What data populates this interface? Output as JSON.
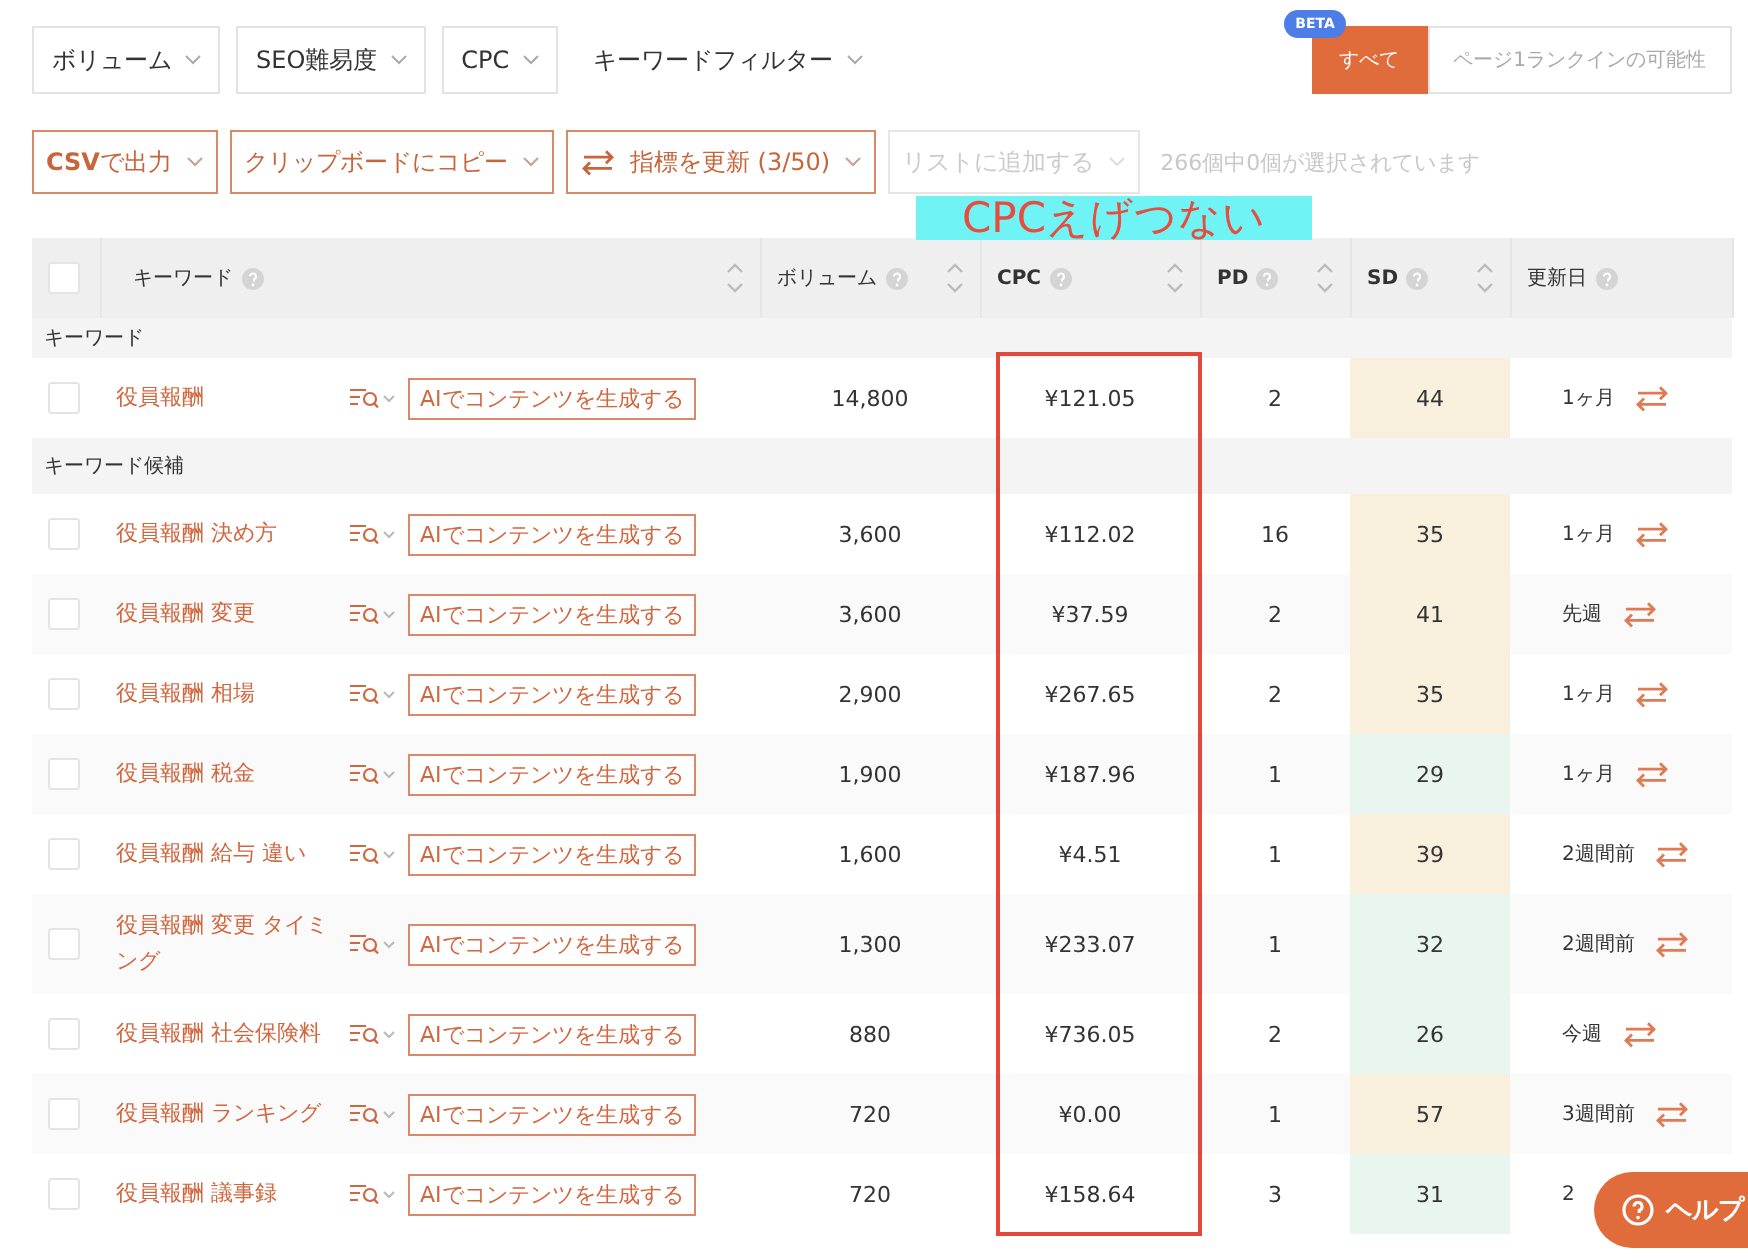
{
  "filters": [
    {
      "label": "ボリューム",
      "boxed": true
    },
    {
      "label": "SEO難易度",
      "boxed": true
    },
    {
      "label": "CPC",
      "boxed": true
    },
    {
      "label": "キーワードフィルター",
      "boxed": false
    }
  ],
  "view_tabs": {
    "badge": "BETA",
    "tabs": [
      {
        "label": "すべて",
        "selected": true
      },
      {
        "label": "ページ1ランクインの可能性",
        "selected": false
      }
    ]
  },
  "toolbar": [
    {
      "kind": "bold-prefix",
      "label": "**CSV**で出力",
      "disabled": false
    },
    {
      "kind": "plain",
      "label": "クリップボードにコピー",
      "disabled": false
    },
    {
      "kind": "refresh",
      "label": "指標を更新 (3/50)",
      "disabled": false
    },
    {
      "kind": "plain",
      "label": "リストに追加する",
      "disabled": true
    }
  ],
  "selection_status": "266個中0個が選択されています",
  "annotation": {
    "label": "CPCえげつない"
  },
  "table": {
    "select_all_checked": false,
    "columns": [
      {
        "label": "キーワード",
        "sortable": true
      },
      {
        "label": "ボリューム",
        "sortable": true
      },
      {
        "label": "CPC",
        "sortable": true
      },
      {
        "label": "PD",
        "sortable": true
      },
      {
        "label": "SD",
        "sortable": true
      },
      {
        "label": "更新日",
        "sortable": false
      }
    ],
    "groups": [
      {
        "title": "キーワード",
        "rows": [
          {
            "keyword": "役員報酬",
            "ai_button": "AIでコンテンツを生成する",
            "volume": "14,800",
            "cpc": "¥121.05",
            "pd": "2",
            "sd": {
              "value": "44",
              "color": "#f8efdc"
            },
            "updated": "1ヶ月",
            "checked": false
          }
        ]
      },
      {
        "title": "キーワード候補",
        "rows": [
          {
            "keyword": "役員報酬 決め方",
            "ai_button": "AIでコンテンツを生成する",
            "volume": "3,600",
            "cpc": "¥112.02",
            "pd": "16",
            "sd": {
              "value": "35",
              "color": "#f8efdc"
            },
            "updated": "1ヶ月",
            "checked": false
          },
          {
            "keyword": "役員報酬 変更",
            "ai_button": "AIでコンテンツを生成する",
            "volume": "3,600",
            "cpc": "¥37.59",
            "pd": "2",
            "sd": {
              "value": "41",
              "color": "#f8efdc"
            },
            "updated": "先週",
            "checked": false
          },
          {
            "keyword": "役員報酬 相場",
            "ai_button": "AIでコンテンツを生成する",
            "volume": "2,900",
            "cpc": "¥267.65",
            "pd": "2",
            "sd": {
              "value": "35",
              "color": "#f8efdc"
            },
            "updated": "1ヶ月",
            "checked": false
          },
          {
            "keyword": "役員報酬 税金",
            "ai_button": "AIでコンテンツを生成する",
            "volume": "1,900",
            "cpc": "¥187.96",
            "pd": "1",
            "sd": {
              "value": "29",
              "color": "#e9f6f0"
            },
            "updated": "1ヶ月",
            "checked": false
          },
          {
            "keyword": "役員報酬 給与 違い",
            "ai_button": "AIでコンテンツを生成する",
            "volume": "1,600",
            "cpc": "¥4.51",
            "pd": "1",
            "sd": {
              "value": "39",
              "color": "#f8efdc"
            },
            "updated": "2週間前",
            "checked": false
          },
          {
            "keyword": "役員報酬 変更 タイミング",
            "ai_button": "AIでコンテンツを生成する",
            "volume": "1,300",
            "cpc": "¥233.07",
            "pd": "1",
            "sd": {
              "value": "32",
              "color": "#e9f6f0"
            },
            "updated": "2週間前",
            "checked": false
          },
          {
            "keyword": "役員報酬 社会保険料",
            "ai_button": "AIでコンテンツを生成する",
            "volume": "880",
            "cpc": "¥736.05",
            "pd": "2",
            "sd": {
              "value": "26",
              "color": "#e9f6f0"
            },
            "updated": "今週",
            "checked": false
          },
          {
            "keyword": "役員報酬 ランキング",
            "ai_button": "AIでコンテンツを生成する",
            "volume": "720",
            "cpc": "¥0.00",
            "pd": "1",
            "sd": {
              "value": "57",
              "color": "#f8efdc"
            },
            "updated": "3週間前",
            "checked": false
          },
          {
            "keyword": "役員報酬 議事録",
            "ai_button": "AIでコンテンツを生成する",
            "volume": "720",
            "cpc": "¥158.64",
            "pd": "3",
            "sd": {
              "value": "31",
              "color": "#e9f6f0"
            },
            "updated": "2",
            "refresh_shown": false,
            "checked": false
          }
        ]
      }
    ]
  },
  "help_button": {
    "label": "ヘルプ"
  }
}
